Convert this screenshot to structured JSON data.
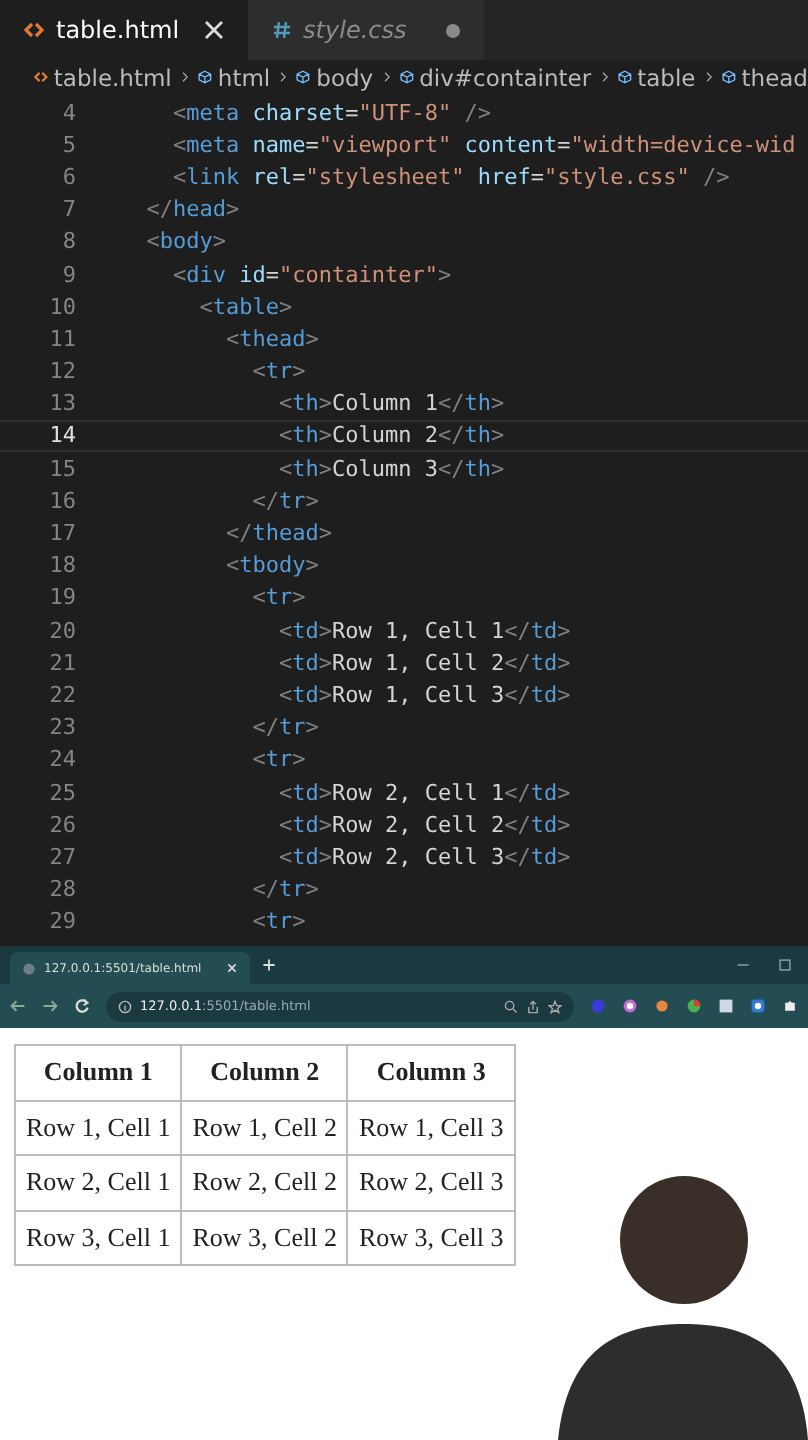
{
  "editor_tabs": [
    {
      "label": "table.html",
      "kind": "html",
      "selected": true,
      "modified": false
    },
    {
      "label": "style.css",
      "kind": "css",
      "selected": false,
      "modified": true
    }
  ],
  "breadcrumb": [
    {
      "label": "table.html",
      "kind": "file"
    },
    {
      "label": "html",
      "kind": "element"
    },
    {
      "label": "body",
      "kind": "element"
    },
    {
      "label": "div#containter",
      "kind": "element"
    },
    {
      "label": "table",
      "kind": "element"
    },
    {
      "label": "thead",
      "kind": "element"
    }
  ],
  "code_lines": [
    {
      "number": "4",
      "text": "    <meta charset=\"UTF-8\" />",
      "current": false
    },
    {
      "number": "5",
      "text": "    <meta name=\"viewport\" content=\"width=device-wid",
      "current": false
    },
    {
      "number": "6",
      "text": "    <link rel=\"stylesheet\" href=\"style.css\" />",
      "current": false
    },
    {
      "number": "7",
      "text": "  </head>",
      "current": false
    },
    {
      "number": "8",
      "text": "  <body>",
      "current": false
    },
    {
      "number": "9",
      "text": "    <div id=\"containter\">",
      "current": false
    },
    {
      "number": "10",
      "text": "      <table>",
      "current": false
    },
    {
      "number": "11",
      "text": "        <thead>",
      "current": false
    },
    {
      "number": "12",
      "text": "          <tr>",
      "current": false
    },
    {
      "number": "13",
      "text": "            <th>Column 1</th>",
      "current": false
    },
    {
      "number": "14",
      "text": "            <th>Column 2</th>",
      "current": true
    },
    {
      "number": "15",
      "text": "            <th>Column 3</th>",
      "current": false
    },
    {
      "number": "16",
      "text": "          </tr>",
      "current": false
    },
    {
      "number": "17",
      "text": "        </thead>",
      "current": false
    },
    {
      "number": "18",
      "text": "        <tbody>",
      "current": false
    },
    {
      "number": "19",
      "text": "          <tr>",
      "current": false
    },
    {
      "number": "20",
      "text": "            <td>Row 1, Cell 1</td>",
      "current": false
    },
    {
      "number": "21",
      "text": "            <td>Row 1, Cell 2</td>",
      "current": false
    },
    {
      "number": "22",
      "text": "            <td>Row 1, Cell 3</td>",
      "current": false
    },
    {
      "number": "23",
      "text": "          </tr>",
      "current": false
    },
    {
      "number": "24",
      "text": "          <tr>",
      "current": false
    },
    {
      "number": "25",
      "text": "            <td>Row 2, Cell 1</td>",
      "current": false
    },
    {
      "number": "26",
      "text": "            <td>Row 2, Cell 2</td>",
      "current": false
    },
    {
      "number": "27",
      "text": "            <td>Row 2, Cell 3</td>",
      "current": false
    },
    {
      "number": "28",
      "text": "          </tr>",
      "current": false
    },
    {
      "number": "29",
      "text": "          <tr>",
      "current": false
    }
  ],
  "browser": {
    "tab_title": "127.0.0.1:5501/table.html",
    "address_host": "127.0.0.1",
    "address_path": ":5501/table.html",
    "table": {
      "columns": [
        "Column 1",
        "Column 2",
        "Column 3"
      ],
      "rows": [
        [
          "Row 1, Cell 1",
          "Row 1, Cell 2",
          "Row 1, Cell 3"
        ],
        [
          "Row 2, Cell 1",
          "Row 2, Cell 2",
          "Row 2, Cell 3"
        ],
        [
          "Row 3, Cell 1",
          "Row 3, Cell 2",
          "Row 3, Cell 3"
        ]
      ]
    }
  }
}
